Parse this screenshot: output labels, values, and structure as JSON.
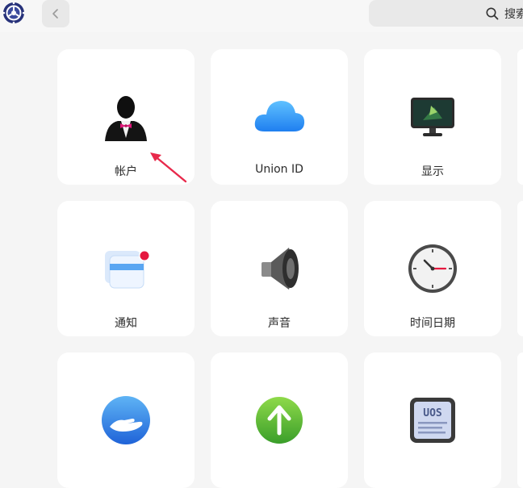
{
  "search": {
    "placeholder": "搜索"
  },
  "cards": [
    {
      "label": "帐户",
      "icon": "account-icon"
    },
    {
      "label": "Union ID",
      "icon": "cloud-icon"
    },
    {
      "label": "显示",
      "icon": "monitor-icon"
    },
    {
      "label": "通知",
      "icon": "notification-icon"
    },
    {
      "label": "声音",
      "icon": "speaker-icon"
    },
    {
      "label": "时间日期",
      "icon": "clock-icon"
    },
    {
      "label": "",
      "icon": "hand-icon"
    },
    {
      "label": "",
      "icon": "update-icon"
    },
    {
      "label": "",
      "icon": "uos-system-icon"
    }
  ],
  "colors": {
    "background": "#f5f5f5",
    "card": "#ffffff",
    "arrow": "#e8294b"
  }
}
